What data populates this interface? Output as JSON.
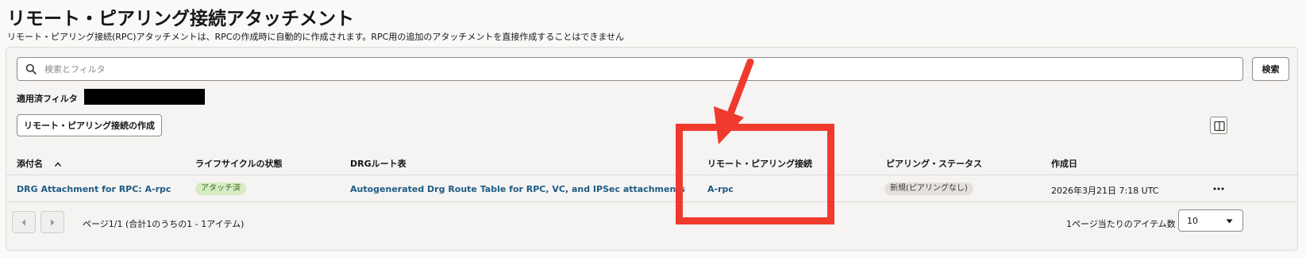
{
  "page": {
    "title": "リモート・ピアリング接続アタッチメント",
    "description": "リモート・ピアリング接続(RPC)アタッチメントは、RPCの作成時に自動的に作成されます。RPC用の追加のアタッチメントを直接作成することはできません"
  },
  "search": {
    "placeholder": "検索とフィルタ",
    "value": "",
    "button_label": "検索"
  },
  "filters": {
    "applied_label": "適用済フィルタ"
  },
  "toolbar": {
    "create_label": "リモート・ピアリング接続の作成"
  },
  "table": {
    "headers": [
      "添付名",
      "ライフサイクルの状態",
      "DRGルート表",
      "リモート・ピアリング接続",
      "ピアリング・ステータス",
      "作成日"
    ],
    "rows": [
      {
        "name": "DRG Attachment for RPC: A-rpc",
        "lifecycle": "アタッチ済",
        "route_table": "Autogenerated Drg Route Table for RPC, VC, and IPSec attachments",
        "rpc": "A-rpc",
        "peering_status": "新規(ピアリングなし)",
        "created": "2026年3月21日 7:18 UTC"
      }
    ]
  },
  "pagination": {
    "summary": "ページ1/1 (合計1のうちの1 - 1アイテム)",
    "per_page_label": "1ページ当たりのアイテム数",
    "per_page_value": "10"
  },
  "colors": {
    "accent_link": "#1d5b85",
    "annotation": "#f03a2e",
    "badge_green": "#d7ecc6",
    "badge_gray": "#e4e1dd"
  },
  "icons": [
    "search-icon",
    "sort-ascending-icon",
    "columns-icon",
    "more-actions-icon",
    "chevron-left-icon",
    "chevron-right-icon",
    "chevron-down-icon",
    "annotation-arrow"
  ]
}
